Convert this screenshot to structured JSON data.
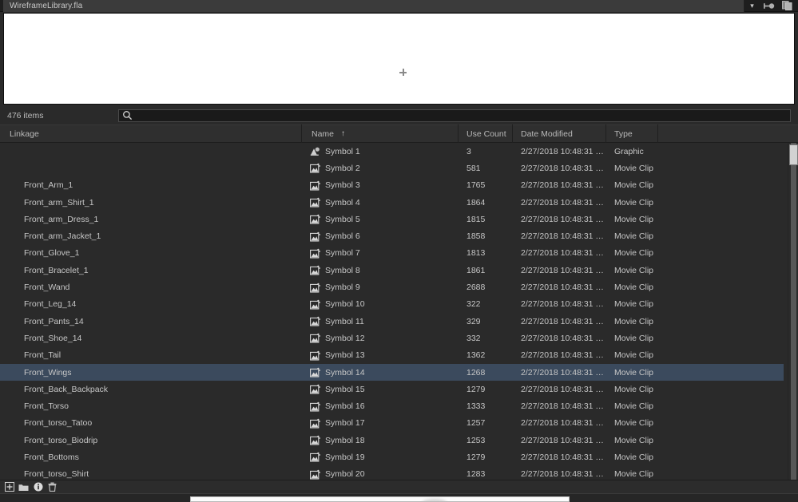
{
  "window": {
    "tab_title": "WireframeLibrary.fla",
    "icons": {
      "chevron": "chevron-down-icon",
      "pin": "pin-icon",
      "panel_menu": "duplicate-panel-icon"
    }
  },
  "preview": {
    "marker": "registration-crosshair"
  },
  "toolbar": {
    "item_count": "476 items",
    "search_value": "",
    "search_placeholder": ""
  },
  "columns": [
    {
      "label": "Linkage",
      "sorted": false
    },
    {
      "label": "Name",
      "sorted": true,
      "sort_arrow": "↑"
    },
    {
      "label": "Use Count",
      "sorted": false
    },
    {
      "label": "Date Modified",
      "sorted": false
    },
    {
      "label": "Type",
      "sorted": false
    }
  ],
  "rows": [
    {
      "linkage": "",
      "name": "Symbol 1",
      "use_count": "3",
      "date": "2/27/2018 10:48:31 …",
      "type": "Graphic",
      "icon": "graphic-symbol-icon",
      "selected": false
    },
    {
      "linkage": "",
      "name": "Symbol 2",
      "use_count": "581",
      "date": "2/27/2018 10:48:31 …",
      "type": "Movie Clip",
      "icon": "movie-clip-icon",
      "selected": false
    },
    {
      "linkage": "Front_Arm_1",
      "name": "Symbol 3",
      "use_count": "1765",
      "date": "2/27/2018 10:48:31 …",
      "type": "Movie Clip",
      "icon": "movie-clip-icon",
      "selected": false
    },
    {
      "linkage": "Front_arm_Shirt_1",
      "name": "Symbol 4",
      "use_count": "1864",
      "date": "2/27/2018 10:48:31 …",
      "type": "Movie Clip",
      "icon": "movie-clip-icon",
      "selected": false
    },
    {
      "linkage": "Front_arm_Dress_1",
      "name": "Symbol 5",
      "use_count": "1815",
      "date": "2/27/2018 10:48:31 …",
      "type": "Movie Clip",
      "icon": "movie-clip-icon",
      "selected": false
    },
    {
      "linkage": "Front_arm_Jacket_1",
      "name": "Symbol 6",
      "use_count": "1858",
      "date": "2/27/2018 10:48:31 …",
      "type": "Movie Clip",
      "icon": "movie-clip-icon",
      "selected": false
    },
    {
      "linkage": "Front_Glove_1",
      "name": "Symbol 7",
      "use_count": "1813",
      "date": "2/27/2018 10:48:31 …",
      "type": "Movie Clip",
      "icon": "movie-clip-icon",
      "selected": false
    },
    {
      "linkage": "Front_Bracelet_1",
      "name": "Symbol 8",
      "use_count": "1861",
      "date": "2/27/2018 10:48:31 …",
      "type": "Movie Clip",
      "icon": "movie-clip-icon",
      "selected": false
    },
    {
      "linkage": "Front_Wand",
      "name": "Symbol 9",
      "use_count": "2688",
      "date": "2/27/2018 10:48:31 …",
      "type": "Movie Clip",
      "icon": "movie-clip-icon",
      "selected": false
    },
    {
      "linkage": "Front_Leg_14",
      "name": "Symbol 10",
      "use_count": "322",
      "date": "2/27/2018 10:48:31 …",
      "type": "Movie Clip",
      "icon": "movie-clip-icon",
      "selected": false
    },
    {
      "linkage": "Front_Pants_14",
      "name": "Symbol 11",
      "use_count": "329",
      "date": "2/27/2018 10:48:31 …",
      "type": "Movie Clip",
      "icon": "movie-clip-icon",
      "selected": false
    },
    {
      "linkage": "Front_Shoe_14",
      "name": "Symbol 12",
      "use_count": "332",
      "date": "2/27/2018 10:48:31 …",
      "type": "Movie Clip",
      "icon": "movie-clip-icon",
      "selected": false
    },
    {
      "linkage": "Front_Tail",
      "name": "Symbol 13",
      "use_count": "1362",
      "date": "2/27/2018 10:48:31 …",
      "type": "Movie Clip",
      "icon": "movie-clip-icon",
      "selected": false
    },
    {
      "linkage": "Front_Wings",
      "name": "Symbol 14",
      "use_count": "1268",
      "date": "2/27/2018 10:48:31 …",
      "type": "Movie Clip",
      "icon": "movie-clip-icon",
      "selected": true
    },
    {
      "linkage": "Front_Back_Backpack",
      "name": "Symbol 15",
      "use_count": "1279",
      "date": "2/27/2018 10:48:31 …",
      "type": "Movie Clip",
      "icon": "movie-clip-icon",
      "selected": false
    },
    {
      "linkage": "Front_Torso",
      "name": "Symbol 16",
      "use_count": "1333",
      "date": "2/27/2018 10:48:31 …",
      "type": "Movie Clip",
      "icon": "movie-clip-icon",
      "selected": false
    },
    {
      "linkage": "Front_torso_Tatoo",
      "name": "Symbol 17",
      "use_count": "1257",
      "date": "2/27/2018 10:48:31 …",
      "type": "Movie Clip",
      "icon": "movie-clip-icon",
      "selected": false
    },
    {
      "linkage": "Front_torso_Biodrip",
      "name": "Symbol 18",
      "use_count": "1253",
      "date": "2/27/2018 10:48:31 …",
      "type": "Movie Clip",
      "icon": "movie-clip-icon",
      "selected": false
    },
    {
      "linkage": "Front_Bottoms",
      "name": "Symbol 19",
      "use_count": "1279",
      "date": "2/27/2018 10:48:31 …",
      "type": "Movie Clip",
      "icon": "movie-clip-icon",
      "selected": false
    },
    {
      "linkage": "Front_torso_Shirt",
      "name": "Symbol 20",
      "use_count": "1283",
      "date": "2/27/2018 10:48:31 …",
      "type": "Movie Clip",
      "icon": "movie-clip-icon",
      "selected": false
    }
  ],
  "bottom_toolbar": [
    {
      "icon": "new-symbol-icon"
    },
    {
      "icon": "new-folder-icon"
    },
    {
      "icon": "properties-icon"
    },
    {
      "icon": "delete-icon"
    }
  ],
  "colors": {
    "panel_bg": "#2a2a2a",
    "header_bg": "#2f2f2f",
    "selection": "#3b4a5d",
    "text": "#c6c6c6",
    "preview_bg": "#ffffff"
  }
}
